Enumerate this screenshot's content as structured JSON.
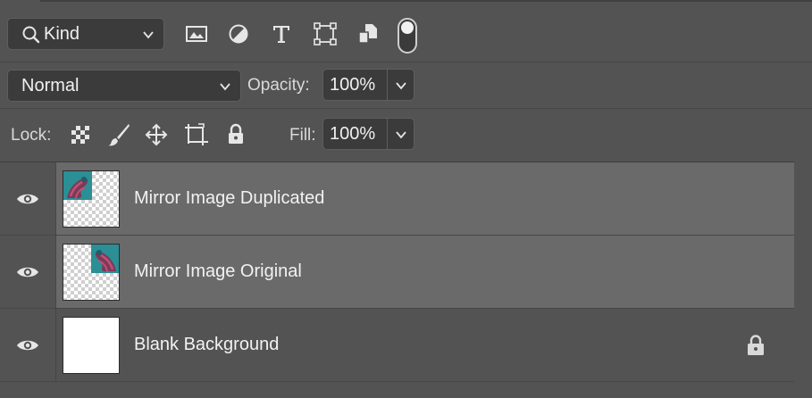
{
  "filter_row": {
    "kind_label": "Kind",
    "icons": [
      "image-filter-icon",
      "adjustment-filter-icon",
      "type-filter-icon",
      "shape-filter-icon",
      "smart-object-filter-icon"
    ],
    "toggle_on": true
  },
  "blend_row": {
    "mode": "Normal",
    "opacity_label": "Opacity:",
    "opacity_value": "100%"
  },
  "lock_row": {
    "lock_label": "Lock:",
    "fill_label": "Fill:",
    "fill_value": "100%"
  },
  "layers": [
    {
      "name": "Mirror Image Duplicated",
      "visible": true,
      "selected": true,
      "locked": false
    },
    {
      "name": "Mirror Image Original",
      "visible": true,
      "selected": true,
      "locked": false
    },
    {
      "name": "Blank Background",
      "visible": true,
      "selected": false,
      "locked": true
    }
  ],
  "colors": {
    "panel": "#535353",
    "selected_row": "#6a6a6a",
    "field": "#3b3b3b",
    "text": "#f0f0f0"
  }
}
